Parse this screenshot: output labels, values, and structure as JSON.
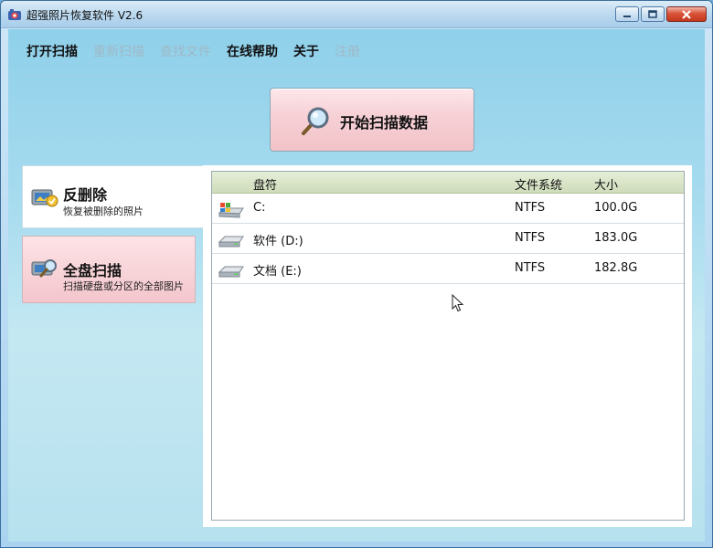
{
  "window": {
    "title": "超强照片恢复软件 V2.6"
  },
  "menu": [
    {
      "label": "打开扫描",
      "enabled": true
    },
    {
      "label": "重新扫描",
      "enabled": false
    },
    {
      "label": "查找文件",
      "enabled": false
    },
    {
      "label": "在线帮助",
      "enabled": true
    },
    {
      "label": "关于",
      "enabled": true
    },
    {
      "label": "注册",
      "enabled": false
    }
  ],
  "scan_button": {
    "label": "开始扫描数据",
    "icon": "magnifier-icon"
  },
  "modes": [
    {
      "title": "反删除",
      "subtitle": "恢复被删除的照片",
      "active": true,
      "icon": "undelete-icon"
    },
    {
      "title": "全盘扫描",
      "subtitle": "扫描硬盘或分区的全部图片",
      "active": false,
      "icon": "disk-scan-icon"
    }
  ],
  "drive_table": {
    "columns": [
      "盘符",
      "文件系统",
      "大小"
    ],
    "rows": [
      {
        "drive": "C:",
        "fs": "NTFS",
        "size": "100.0G",
        "icon": "system-drive-icon"
      },
      {
        "drive": "软件 (D:)",
        "fs": "NTFS",
        "size": "183.0G",
        "icon": "hard-drive-icon"
      },
      {
        "drive": "文档 (E:)",
        "fs": "NTFS",
        "size": "182.8G",
        "icon": "hard-drive-icon"
      }
    ]
  },
  "colors": {
    "accent_pink": "#f3c6cc",
    "header_green": "#cfdcba",
    "window_blue": "#a8dcef"
  }
}
